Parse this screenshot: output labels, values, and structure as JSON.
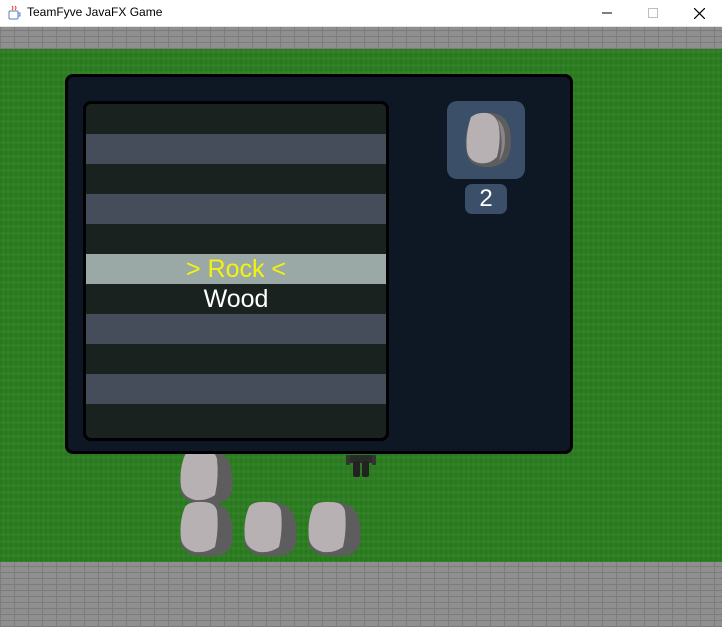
{
  "window": {
    "title": "TeamFyve JavaFX Game",
    "icon": "java-icon",
    "controls": [
      "minimize-icon",
      "maximize-icon",
      "close-icon"
    ]
  },
  "colors": {
    "grass": "#2b7d1f",
    "wall": "#8f8f8f",
    "panel": "#0e1824",
    "row_dark": "#19221e",
    "row_light": "#464d5a",
    "row_selected_bg": "#9aa9a5",
    "selected_text": "#f3f30c",
    "slot_bg": "#3b4f68"
  },
  "menu": {
    "items": [
      {
        "label": "",
        "style": "dark"
      },
      {
        "label": "",
        "style": "light"
      },
      {
        "label": "",
        "style": "dark"
      },
      {
        "label": "",
        "style": "light"
      },
      {
        "label": "",
        "style": "dark"
      },
      {
        "label": "> Rock <",
        "style": "selected"
      },
      {
        "label": "Wood",
        "style": "dark"
      },
      {
        "label": "",
        "style": "light"
      },
      {
        "label": "",
        "style": "dark"
      },
      {
        "label": "",
        "style": "light"
      },
      {
        "label": "",
        "style": "dark"
      }
    ],
    "selected_index": 5
  },
  "inventory": {
    "item_icon": "rock-icon",
    "count": "2"
  }
}
